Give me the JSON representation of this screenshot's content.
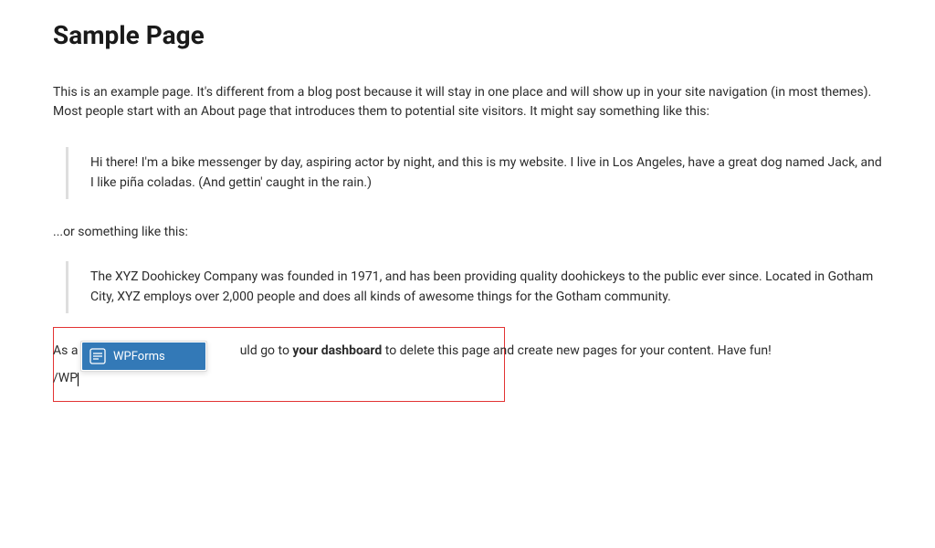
{
  "title": "Sample Page",
  "intro": "This is an example page. It's different from a blog post because it will stay in one place and will show up in your site navigation (in most themes). Most people start with an About page that introduces them to potential site visitors. It might say something like this:",
  "quote1": "Hi there! I'm a bike messenger by day, aspiring actor by night, and this is my website. I live in Los Angeles, have a great dog named Jack, and I like piña coladas. (And gettin' caught in the rain.)",
  "mid_line": "...or something like this:",
  "quote2": "The XYZ Doohickey Company was founded in 1971, and has been providing quality doohickeys to the public ever since. Located in Gotham City, XYZ employs over 2,000 people and does all kinds of awesome things for the Gotham community.",
  "final": {
    "prefix": "As a ",
    "obscured_gap": "                                                   ",
    "mid": "uld go to ",
    "bold": "your dashboard",
    "suffix": " to delete this page and create new pages for your content. Have fun!"
  },
  "typed": "/WP",
  "dropdown": {
    "label": "WPForms"
  }
}
